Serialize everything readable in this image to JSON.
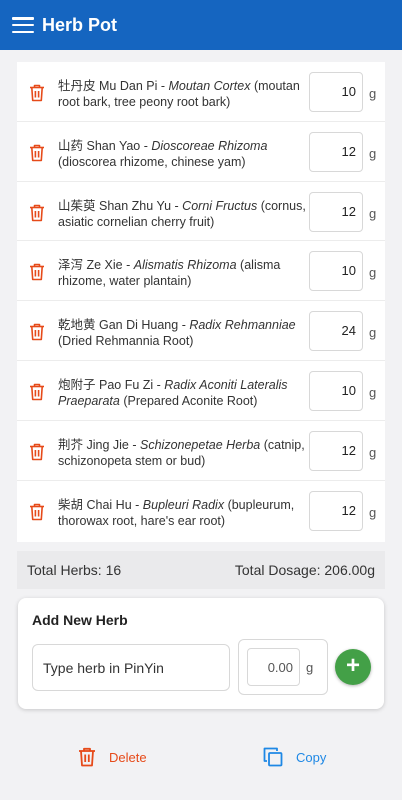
{
  "appbar": {
    "title": "Herb Pot"
  },
  "herbs": [
    {
      "chinese": "牡丹皮",
      "pinyin": "Mu Dan Pi",
      "latin": "Moutan Cortex",
      "english": "(moutan root bark, tree peony root bark)",
      "qty": "10",
      "unit": "g"
    },
    {
      "chinese": "山药",
      "pinyin": "Shan Yao",
      "latin": "Dioscoreae Rhizoma",
      "english": "(dioscorea rhizome, chinese yam)",
      "qty": "12",
      "unit": "g"
    },
    {
      "chinese": "山茱萸",
      "pinyin": "Shan Zhu Yu",
      "latin": "Corni Fructus",
      "english": "(cornus, asiatic cornelian cherry fruit)",
      "qty": "12",
      "unit": "g"
    },
    {
      "chinese": "泽泻",
      "pinyin": "Ze Xie",
      "latin": "Alismatis Rhizoma",
      "english": "(alisma rhizome, water plantain)",
      "qty": "10",
      "unit": "g"
    },
    {
      "chinese": "乾地黄",
      "pinyin": "Gan Di Huang",
      "latin": "Radix Rehmanniae",
      "english": "(Dried Rehmannia Root)",
      "qty": "24",
      "unit": "g"
    },
    {
      "chinese": "炮附子",
      "pinyin": "Pao Fu Zi",
      "latin": "Radix Aconiti Lateralis Praeparata",
      "english": "(Prepared Aconite Root)",
      "qty": "10",
      "unit": "g"
    },
    {
      "chinese": "荆芥",
      "pinyin": "Jing Jie",
      "latin": "Schizonepetae Herba",
      "english": "(catnip, schizonopeta stem or bud)",
      "qty": "12",
      "unit": "g"
    },
    {
      "chinese": "柴胡",
      "pinyin": "Chai Hu",
      "latin": "Bupleuri Radix",
      "english": "(bupleurum, thorowax root, hare's ear root)",
      "qty": "12",
      "unit": "g"
    }
  ],
  "totals": {
    "herbs_label": "Total Herbs: 16",
    "dosage_label": "Total Dosage: 206.00g"
  },
  "add_card": {
    "title": "Add New Herb",
    "herb_placeholder": "Type herb in PinYin",
    "dose_placeholder": "0.00",
    "dose_unit": "g",
    "add_symbol": "+"
  },
  "actions": {
    "delete_label": "Delete",
    "copy_label": "Copy"
  },
  "colors": {
    "appbar": "#1565c0",
    "delete": "#e64a19",
    "copy": "#1e88e5",
    "add": "#43a047"
  },
  "icons": {
    "menu": "menu-icon",
    "trash": "trash-icon",
    "copy": "copy-icon",
    "add": "plus-icon"
  }
}
